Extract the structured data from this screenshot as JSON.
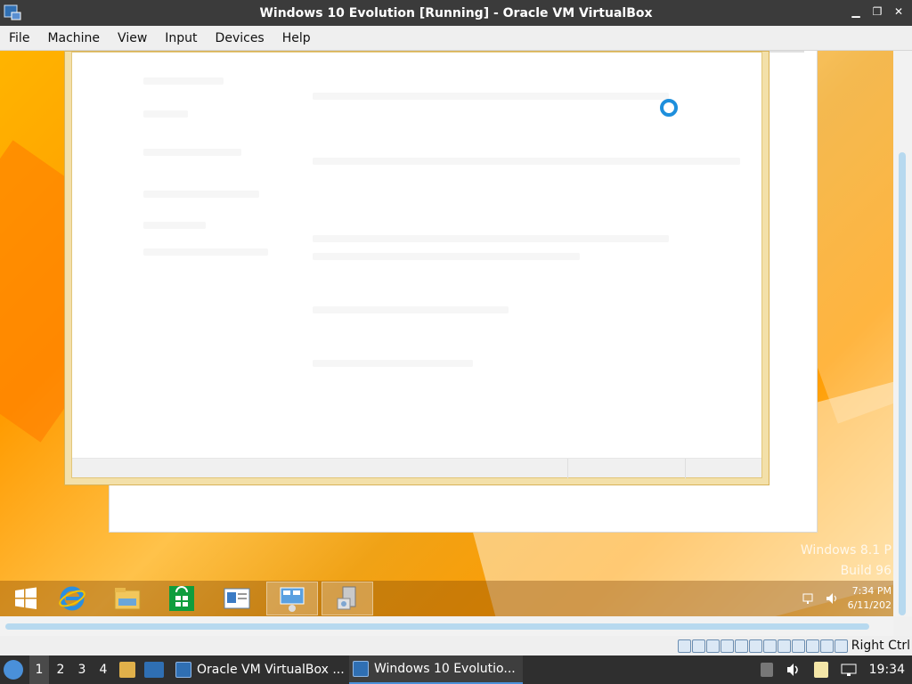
{
  "window": {
    "title": "Windows 10 Evolution [Running] - Oracle VM VirtualBox",
    "app_icon": "virtualbox-vm-icon",
    "controls": [
      "minimize-icon",
      "restore-icon",
      "close-icon"
    ]
  },
  "menubar": {
    "items": [
      "File",
      "Machine",
      "View",
      "Input",
      "Devices",
      "Help"
    ]
  },
  "guest": {
    "watermark": {
      "line1": "Windows 8.1 P",
      "line2": "Build 96"
    },
    "taskbar": {
      "apps": [
        {
          "icon": "windows-start-icon"
        },
        {
          "icon": "internet-explorer-icon"
        },
        {
          "icon": "file-explorer-icon"
        },
        {
          "icon": "store-icon"
        },
        {
          "icon": "control-panel-icon"
        },
        {
          "icon": "remote-desktop-icon",
          "active": true
        },
        {
          "icon": "installer-icon",
          "active": true
        }
      ],
      "clock": {
        "time": "7:34 PM",
        "date": "6/11/202"
      }
    }
  },
  "vm_status": {
    "host_key": "Right Ctrl",
    "icons": [
      "hard-disk-icon",
      "optical-drive-icon",
      "audio-icon",
      "network-icon",
      "usb-icon",
      "shared-folders-icon",
      "display-icon",
      "recording-icon",
      "vt-x-icon",
      "cpu-icon",
      "mouse-integration-icon",
      "keyboard-icon"
    ]
  },
  "host_panel": {
    "workspaces": [
      "1",
      "2",
      "3",
      "4"
    ],
    "tasks": [
      {
        "label": "Oracle VM VirtualBox ...",
        "icon": "virtualbox-icon"
      },
      {
        "label": "Windows 10 Evolutio...",
        "icon": "virtualbox-vm-icon",
        "active": true
      }
    ],
    "clock": "19:34"
  },
  "colors": {
    "accent": "#4a90d9",
    "desktop": "#ff9c00",
    "spinner": "#1e8fdc"
  }
}
